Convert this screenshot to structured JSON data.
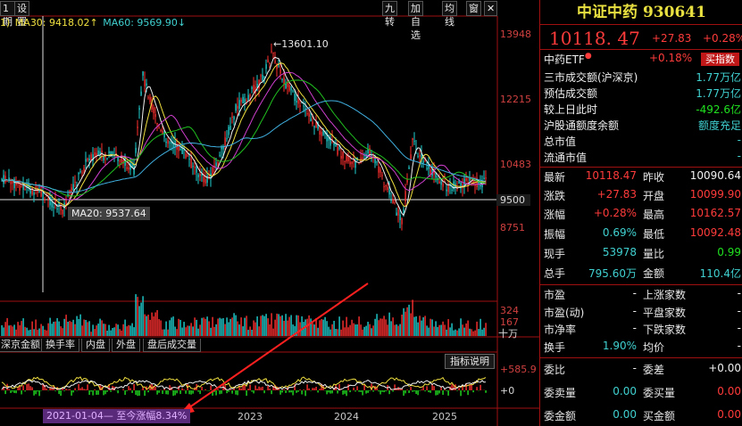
{
  "toolbar": {
    "left_items": [
      "1期",
      "设置"
    ],
    "right_items": [
      "九转",
      "加自选",
      "均线",
      "窗",
      "✕"
    ]
  },
  "ma_legend": {
    "prefix": "1)",
    "ma30": "MA30: 9418.02↑",
    "ma60": "MA60: 9569.90↓"
  },
  "price_axis": [
    "13948",
    "12215",
    "10483",
    "9500",
    "8751"
  ],
  "peak_label": "←13601.10",
  "ma20_tag": "MA20: 9537.64",
  "volume_axis": [
    "324",
    "167",
    "十万"
  ],
  "indicator_tabs": [
    "深京金额",
    "换手率",
    "内盘",
    "外盘",
    "盘后成交量"
  ],
  "explain_button": "指标说明",
  "indicator_axis": [
    "+585.9",
    "+0"
  ],
  "range_badge": "2021-01-04— 至今涨幅8.34%",
  "x_years": [
    "2023",
    "2024",
    "2025"
  ],
  "quote": {
    "title": "中证中药 930641",
    "price": "10118. 47",
    "change": "+27.83",
    "change_pct": "+0.28%",
    "etf_name": "中药ETF",
    "etf_pct": "+0.18%",
    "buy_button": "买指数",
    "info_rows": [
      {
        "label": "三市成交额(沪深京)",
        "value": "1.77万亿"
      },
      {
        "label": "预估成交额",
        "value": "1.77万亿"
      },
      {
        "label": "较上日此时",
        "value": "-492.6亿"
      },
      {
        "label": "沪股通额度余额",
        "value": "额度充足"
      },
      {
        "label": "总市值",
        "value": "-"
      },
      {
        "label": "流通市值",
        "value": "-"
      }
    ],
    "grid1": [
      {
        "a": "最新",
        "b": "10118.47",
        "c": "昨收",
        "d": "10090.64"
      },
      {
        "a": "涨跌",
        "b": "+27.83",
        "c": "开盘",
        "d": "10099.90"
      },
      {
        "a": "涨幅",
        "b": "+0.28%",
        "c": "最高",
        "d": "10162.57"
      },
      {
        "a": "振幅",
        "b": "0.69%",
        "c": "最低",
        "d": "10092.48"
      },
      {
        "a": "现手",
        "b": "53978",
        "c": "量比",
        "d": "0.99"
      },
      {
        "a": "总手",
        "b": "795.60万",
        "c": "金额",
        "d": "110.4亿"
      }
    ],
    "grid2": [
      {
        "a": "市盈",
        "b": "-",
        "c": "上涨家数",
        "d": "-"
      },
      {
        "a": "市盈(动)",
        "b": "-",
        "c": "平盘家数",
        "d": "-"
      },
      {
        "a": "市净率",
        "b": "-",
        "c": "下跌家数",
        "d": "-"
      },
      {
        "a": "换手",
        "b": "1.90%",
        "c": "均价",
        "d": "-"
      }
    ],
    "grid3": [
      {
        "a": "委比",
        "b": "-",
        "c": "委差",
        "d": "+0.00"
      },
      {
        "a": "委卖量",
        "b": "0.00",
        "c": "委买量",
        "d": "0.00"
      },
      {
        "a": "委金额",
        "b": "0.00",
        "c": "买金额",
        "d": "0.00"
      }
    ]
  }
}
